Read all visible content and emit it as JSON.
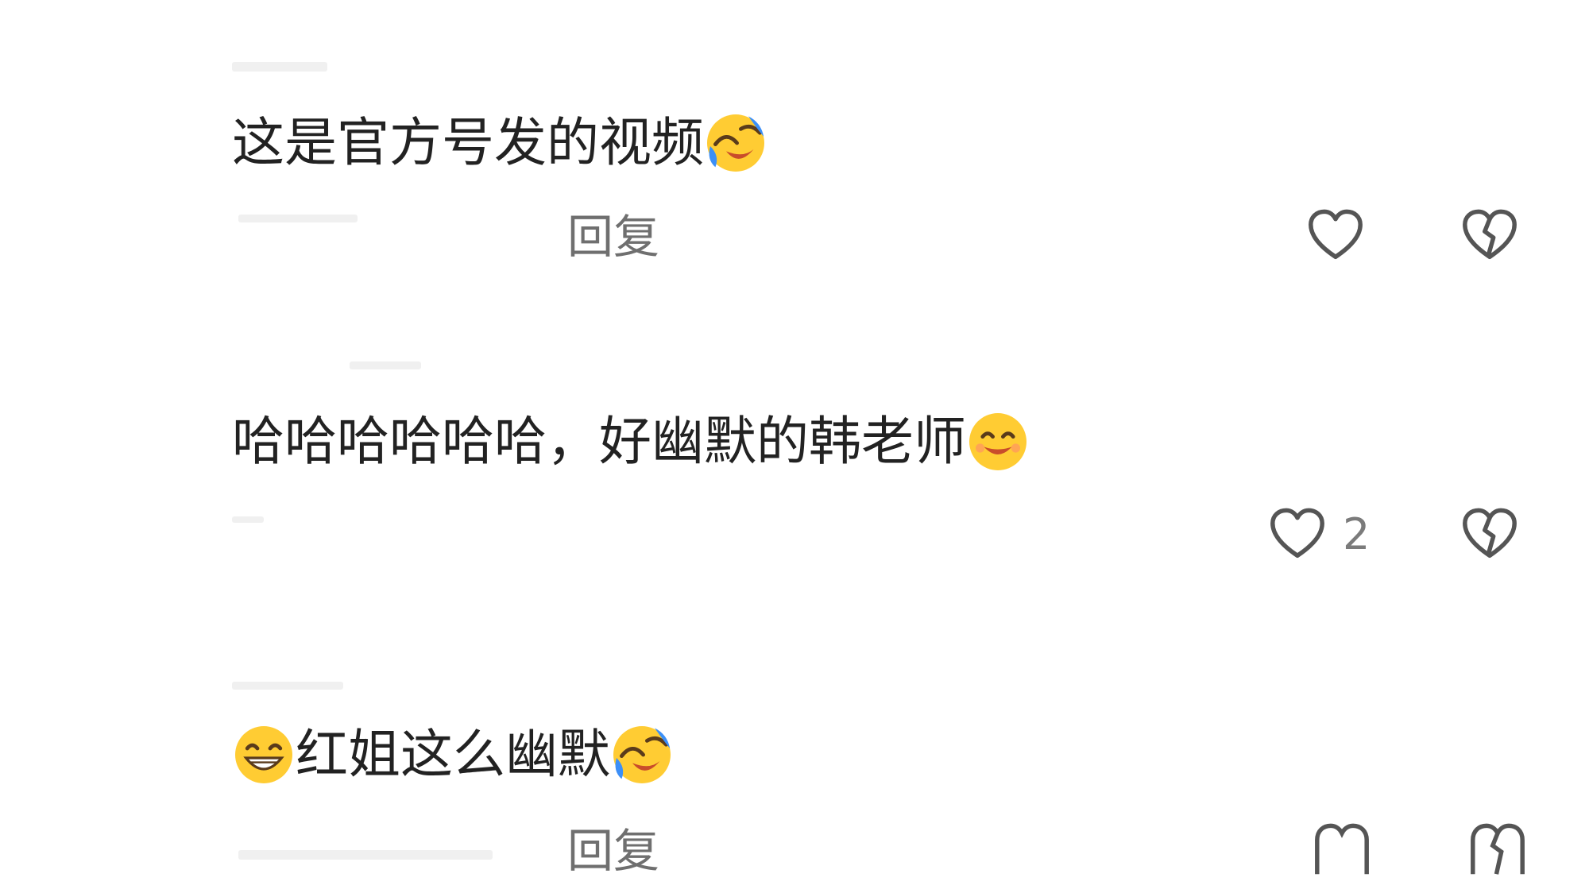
{
  "comments": [
    {
      "text": "这是官方号发的视频",
      "trailing_emoji": "laugh-cry-emoji",
      "reply_label": "回复",
      "like_count": ""
    },
    {
      "text": "哈哈哈哈哈哈，好幽默的韩老师",
      "trailing_emoji": "smile-emoji",
      "reply_label": "",
      "like_count": "2"
    },
    {
      "leading_emoji": "grin-emoji",
      "text": "红姐这么幽默",
      "trailing_emoji": "laugh-cry-emoji",
      "reply_label": "回复",
      "like_count": ""
    }
  ],
  "colors": {
    "icon_gray": "#555555",
    "reply_gray": "#6f6f6f",
    "emoji_yellow": "#ffcc33",
    "emoji_blue": "#3c8ff7"
  }
}
